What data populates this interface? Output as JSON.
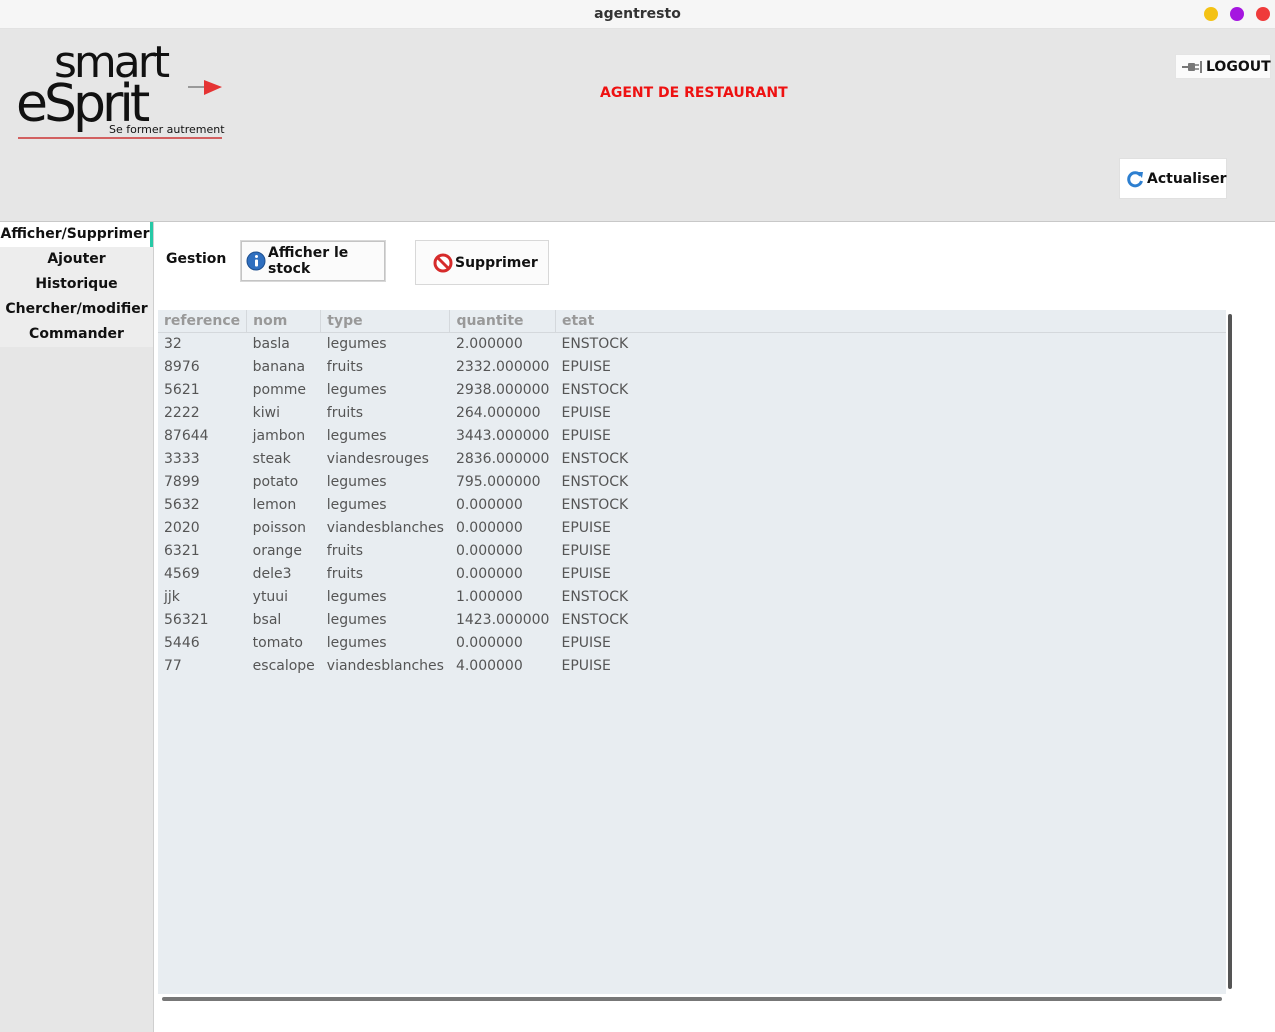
{
  "window": {
    "title": "agentresto"
  },
  "header": {
    "logo": {
      "text_top": "smart",
      "text_main": "eSprit",
      "tagline": "Se former autrement"
    },
    "app_heading": "AGENT DE RESTAURANT",
    "logout_label": "LOGOUT",
    "refresh_label": "Actualiser"
  },
  "sidebar": {
    "items": [
      {
        "label": "Afficher/Supprimer",
        "active": true
      },
      {
        "label": "Ajouter",
        "active": false
      },
      {
        "label": "Historique",
        "active": false
      },
      {
        "label": "Chercher/modifier",
        "active": false
      },
      {
        "label": "Commander",
        "active": false
      }
    ]
  },
  "main": {
    "gestion_label": "Gestion",
    "show_stock_label": "Afficher le stock",
    "delete_label": "Supprimer"
  },
  "table": {
    "columns": [
      "reference",
      "nom",
      "type",
      "quantite",
      "etat"
    ],
    "rows": [
      [
        "32",
        "basla",
        "legumes",
        "2.000000",
        "ENSTOCK"
      ],
      [
        "8976",
        "banana",
        "fruits",
        "2332.000000",
        "EPUISE"
      ],
      [
        "5621",
        "pomme",
        "legumes",
        "2938.000000",
        "ENSTOCK"
      ],
      [
        "2222",
        "kiwi",
        "fruits",
        "264.000000",
        "EPUISE"
      ],
      [
        "87644",
        "jambon",
        "legumes",
        "3443.000000",
        "EPUISE"
      ],
      [
        "3333",
        "steak",
        "viandesrouges",
        "2836.000000",
        "ENSTOCK"
      ],
      [
        "7899",
        "potato",
        "legumes",
        "795.000000",
        "ENSTOCK"
      ],
      [
        "5632",
        "lemon",
        "legumes",
        "0.000000",
        "ENSTOCK"
      ],
      [
        "2020",
        "poisson",
        "viandesblanches",
        "0.000000",
        "EPUISE"
      ],
      [
        "6321",
        "orange",
        "fruits",
        "0.000000",
        "EPUISE"
      ],
      [
        "4569",
        "dele3",
        "fruits",
        "0.000000",
        "EPUISE"
      ],
      [
        "jjk",
        "ytuui",
        "legumes",
        "1.000000",
        "ENSTOCK"
      ],
      [
        "56321",
        "bsal",
        "legumes",
        "1423.000000",
        "ENSTOCK"
      ],
      [
        "5446",
        "tomato",
        "legumes",
        "0.000000",
        "EPUISE"
      ],
      [
        "77",
        "escalope",
        "viandesblanches",
        "4.000000",
        "EPUISE"
      ]
    ]
  },
  "colors": {
    "heading_red": "#ee1111",
    "active_tab_accent": "#26c9a6",
    "table_bg": "#e8edf1"
  },
  "icons": {
    "logout": "plug-icon",
    "refresh": "refresh-icon",
    "show_stock": "info-icon",
    "delete": "no-entry-icon",
    "logo_flag": "red-flag-icon"
  }
}
